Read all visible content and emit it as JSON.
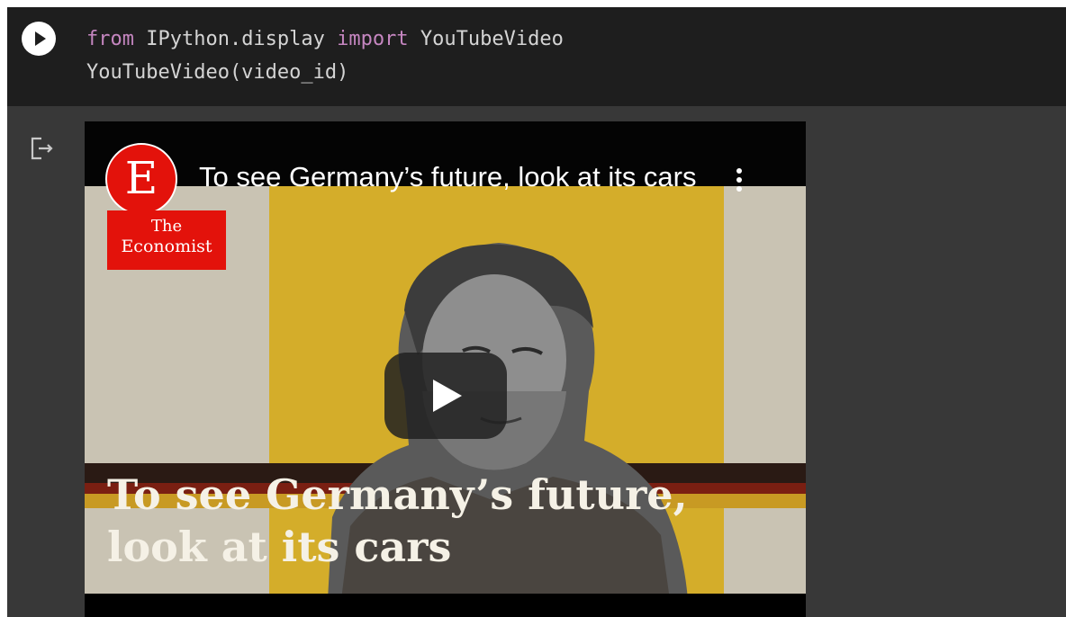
{
  "code_cell": {
    "run_icon": "play-circle-icon",
    "line1": {
      "kw_from": "from",
      "module": " IPython.display ",
      "kw_import": "import",
      "name": " YouTubeVideo"
    },
    "line2": "YouTubeVideo(video_id)"
  },
  "output": {
    "output_icon": "output-redirect-icon",
    "video": {
      "channel_logo_letter": "E",
      "title": "To see Germany’s future, look at its cars",
      "more_icon": "more-vert-icon",
      "badge_line1": "The",
      "badge_line2": "Economist",
      "play_icon": "youtube-play-icon",
      "overlay_line1": "To see Germany’s future,",
      "overlay_line2": "look at its cars"
    }
  },
  "colors": {
    "code_bg": "#1e1e1e",
    "output_bg": "#383838",
    "keyword": "#c586c0",
    "economist_red": "#e3120b",
    "thumb_yellow": "#d4ad2a"
  }
}
